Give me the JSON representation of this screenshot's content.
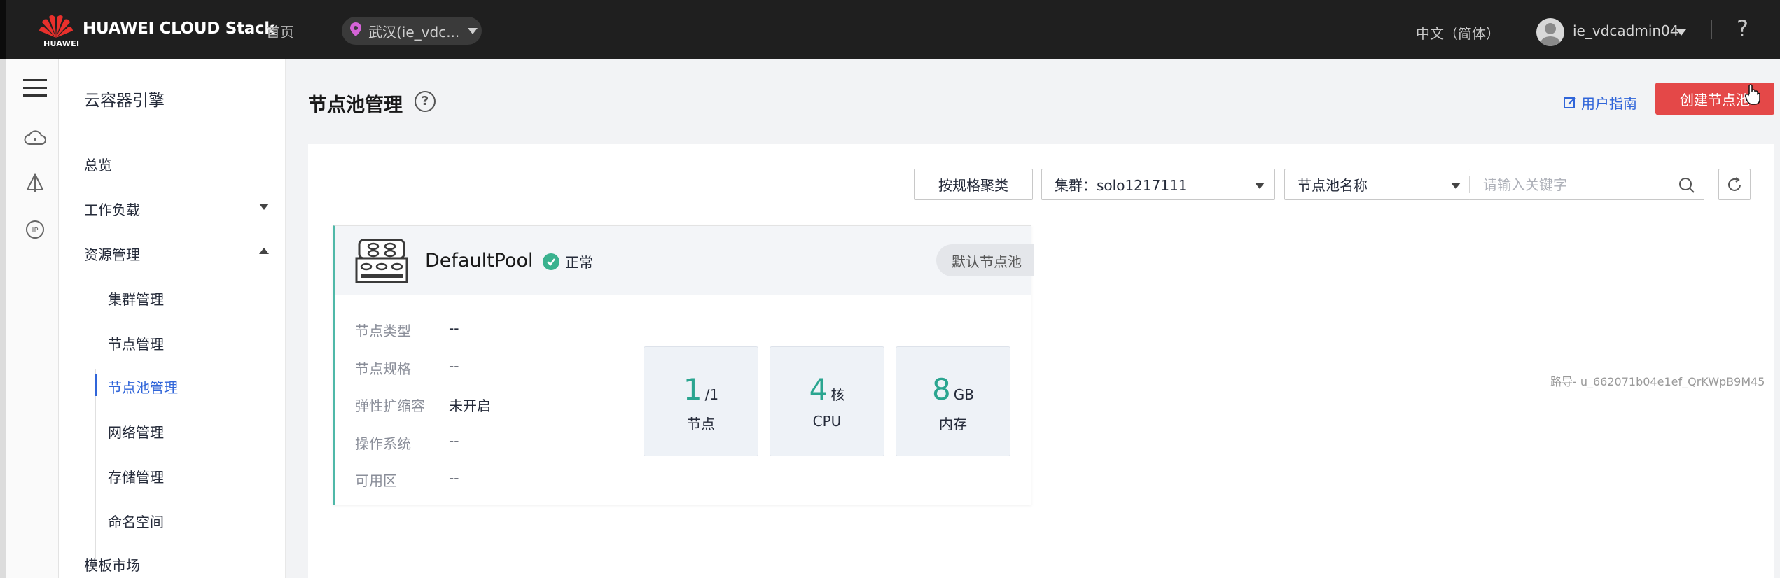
{
  "header": {
    "brand_name": "HUAWEI CLOUD Stack",
    "logo_text": "HUAWEI",
    "home_link": "首页",
    "region": "武汉(ie_vdc...",
    "language": "中文（简体）",
    "username": "ie_vdcadmin04",
    "help": "?"
  },
  "rail": {
    "icons": [
      "menu-icon",
      "cloud-icon",
      "cluster-icon",
      "ip-icon"
    ]
  },
  "subnav": {
    "title": "云容器引擎",
    "items": {
      "overview": "总览",
      "workload": "工作负载",
      "resources": "资源管理",
      "cluster_mgmt": "集群管理",
      "node_mgmt": "节点管理",
      "nodepool_mgmt": "节点池管理",
      "network_mgmt": "网络管理",
      "storage_mgmt": "存储管理",
      "namespace": "命名空间",
      "template_market": "模板市场"
    }
  },
  "page": {
    "title": "节点池管理",
    "user_guide": "用户指南",
    "create_button": "创建节点池"
  },
  "toolbar": {
    "group_by_spec": "按规格聚类",
    "cluster_select": "集群：solo1217111",
    "filter_select": "节点池名称",
    "search_placeholder": "请输入关键字"
  },
  "pool": {
    "name": "DefaultPool",
    "status": "正常",
    "default_tag": "默认节点池",
    "rows": [
      {
        "label": "节点类型",
        "value": "--"
      },
      {
        "label": "节点规格",
        "value": "--"
      },
      {
        "label": "弹性扩缩容",
        "value": "未开启"
      },
      {
        "label": "操作系统",
        "value": "--"
      },
      {
        "label": "可用区",
        "value": "--"
      }
    ],
    "stats": {
      "nodes_value": "1",
      "nodes_total": "/1",
      "nodes_label": "节点",
      "cpu_value": "4",
      "cpu_unit": "核",
      "cpu_label": "CPU",
      "mem_value": "8",
      "mem_unit": "GB",
      "mem_label": "内存"
    }
  },
  "watermark": "路导- u_662071b04e1ef_QrKWpB9M45",
  "colors": {
    "topbar": "#1f1f1f",
    "primary_blue": "#3065d9",
    "create_red": "#e44848",
    "status_green": "#3ab28f",
    "stat_teal": "#2aa590"
  }
}
